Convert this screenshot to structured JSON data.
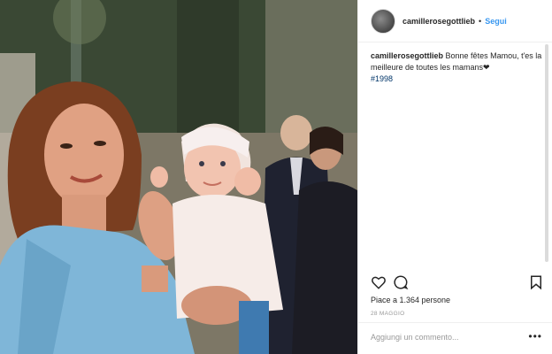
{
  "header": {
    "username": "camillerosegottlieb",
    "separator": "•",
    "follow_label": "Segui",
    "avatar_icon": "avatar"
  },
  "caption": {
    "username": "camillerosegottlieb",
    "text": " Bonne fêtes Mamou, t'es la meilleure de toutes les mamans❤",
    "hashtag": "#1998"
  },
  "actions": {
    "like_icon": "heart-icon",
    "comment_icon": "comment-icon",
    "save_icon": "bookmark-icon"
  },
  "likes": "Piace a 1.364 persone",
  "date": "28 MAGGIO",
  "comment": {
    "placeholder": "Aggiungi un commento...",
    "more_label": "•••"
  },
  "colors": {
    "link": "#3897f0",
    "hashtag": "#003569",
    "muted": "#999999"
  }
}
